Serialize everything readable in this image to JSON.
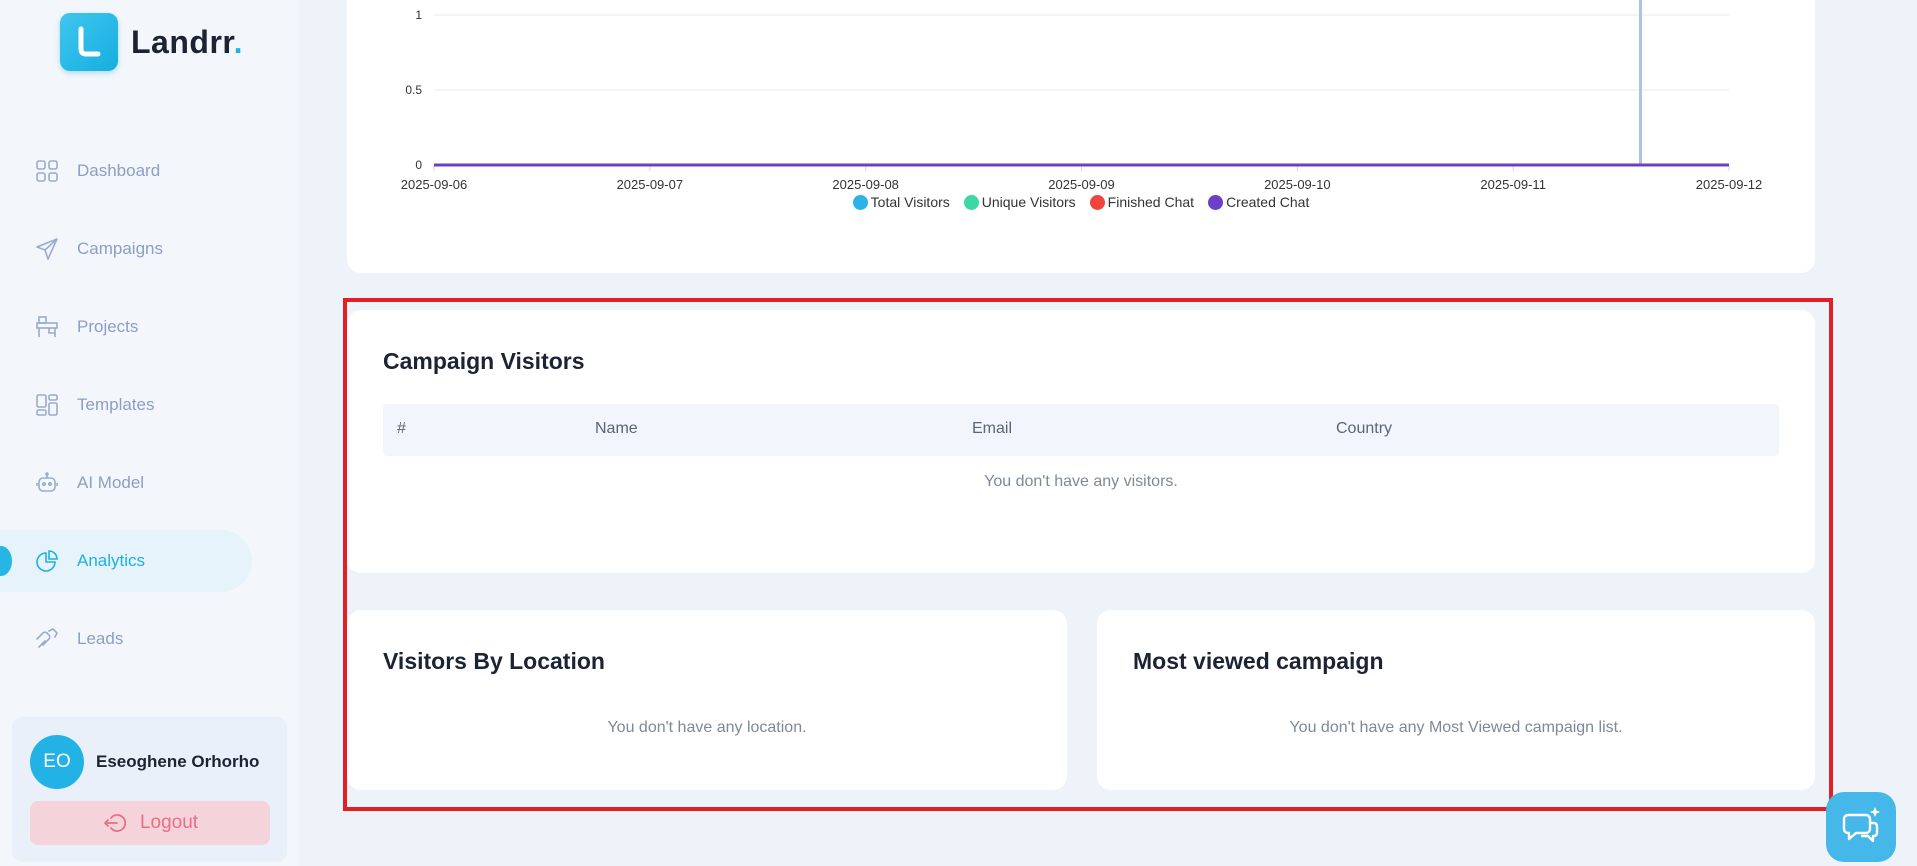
{
  "brand": {
    "name": "Landrr",
    "dot": "."
  },
  "sidebar": {
    "items": [
      {
        "label": "Dashboard",
        "icon": "dashboard-icon"
      },
      {
        "label": "Campaigns",
        "icon": "send-icon"
      },
      {
        "label": "Projects",
        "icon": "projects-icon"
      },
      {
        "label": "Templates",
        "icon": "templates-icon"
      },
      {
        "label": "AI Model",
        "icon": "robot-icon"
      },
      {
        "label": "Analytics",
        "icon": "pie-chart-icon",
        "active": true
      },
      {
        "label": "Leads",
        "icon": "leads-icon"
      }
    ]
  },
  "user": {
    "initials": "EO",
    "name": "Eseoghene Orhorho",
    "logout_label": "Logout"
  },
  "chart_data": {
    "type": "line",
    "x": [
      "2025-09-06",
      "2025-09-07",
      "2025-09-08",
      "2025-09-09",
      "2025-09-10",
      "2025-09-11",
      "2025-09-12"
    ],
    "y_ticks": [
      0,
      0.5,
      1
    ],
    "ylim": [
      0,
      1
    ],
    "series": [
      {
        "name": "Total Visitors",
        "color": "#2bb3e8",
        "values": [
          0,
          0,
          0,
          0,
          0,
          0,
          0
        ]
      },
      {
        "name": "Unique Visitors",
        "color": "#3fd6a5",
        "values": [
          0,
          0,
          0,
          0,
          0,
          0,
          0
        ]
      },
      {
        "name": "Finished Chat",
        "color": "#f0443c",
        "values": [
          0,
          0,
          0,
          0,
          0,
          0,
          0
        ]
      },
      {
        "name": "Created Chat",
        "color": "#6c3fc8",
        "values": [
          0,
          0,
          0,
          0,
          0,
          0,
          0
        ]
      }
    ],
    "grid": true,
    "legend": "bottom",
    "cursor_x": "2025-09-11"
  },
  "campaign_visitors": {
    "title": "Campaign Visitors",
    "columns": [
      "#",
      "Name",
      "Email",
      "Country"
    ],
    "empty": "You don't have any visitors."
  },
  "visitors_by_location": {
    "title": "Visitors By Location",
    "empty": "You don't have any location."
  },
  "most_viewed": {
    "title": "Most viewed campaign",
    "empty": "You don't have any Most Viewed campaign list."
  }
}
